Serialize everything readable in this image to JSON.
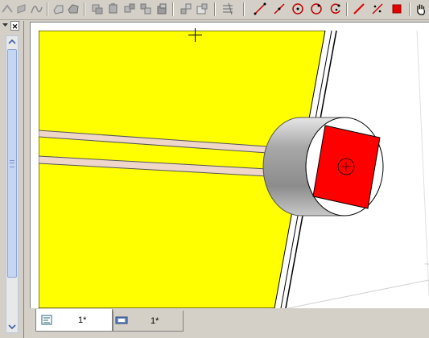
{
  "toolbar": {
    "buttons": [
      {
        "name": "measure-point-icon"
      },
      {
        "name": "measure-edge-icon"
      },
      {
        "name": "curve-icon"
      },
      {
        "name": "solid-icon"
      },
      {
        "name": "surface-icon"
      },
      {
        "name": "copy-icon"
      },
      {
        "name": "paste-icon"
      },
      {
        "name": "move-icon"
      },
      {
        "name": "duplicate-icon"
      },
      {
        "name": "group-icon"
      },
      {
        "name": "properties-icon"
      },
      {
        "name": "layers-icon"
      },
      {
        "name": "line-icon"
      },
      {
        "name": "polyline-icon"
      },
      {
        "name": "circle-center-icon"
      },
      {
        "name": "circle-point-icon"
      },
      {
        "name": "circle-arc-icon"
      },
      {
        "name": "red-line-icon"
      },
      {
        "name": "dimension-icon"
      },
      {
        "name": "red-square-icon"
      },
      {
        "name": "pan-hand-icon"
      }
    ]
  },
  "tabs": [
    {
      "label": "1*",
      "icon": "part-icon"
    },
    {
      "label": "1*",
      "icon": "assembly-icon"
    }
  ],
  "colors": {
    "face_yellow": "#ffff00",
    "face_red": "#ff0000",
    "cylinder_gray": "#a0a0a0",
    "rod": "#efd6c9",
    "scroll_thumb": "#c6d6f2"
  }
}
